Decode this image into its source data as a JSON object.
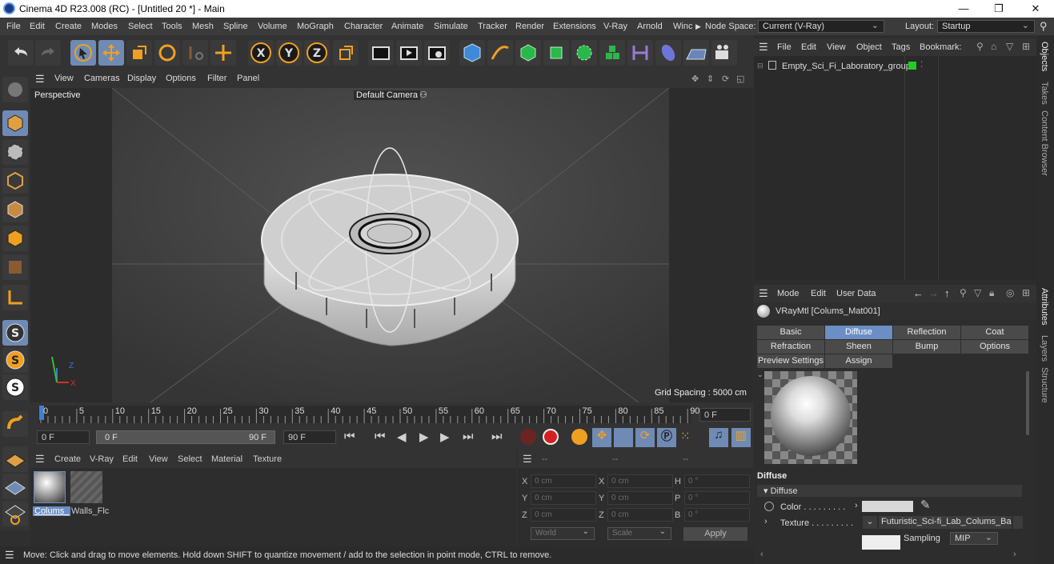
{
  "window": {
    "title": "Cinema 4D R23.008 (RC) - [Untitled 20 *] - Main"
  },
  "menu": {
    "items": [
      "File",
      "Edit",
      "Create",
      "Modes",
      "Select",
      "Tools",
      "Mesh",
      "Spline",
      "Volume",
      "MoGraph",
      "Character",
      "Animate",
      "Simulate",
      "Tracker",
      "Render",
      "Extensions",
      "V-Ray",
      "Arnold",
      "Winc"
    ],
    "node_space_label": "Node Space:",
    "node_space_value": "Current (V-Ray)",
    "layout_label": "Layout:",
    "layout_value": "Startup"
  },
  "viewport": {
    "menu": [
      "View",
      "Cameras",
      "Display",
      "Options",
      "Filter",
      "Panel"
    ],
    "name": "Perspective",
    "camera": "Default Camera",
    "grid_spacing": "Grid Spacing : 5000 cm",
    "axis_z": "Z",
    "axis_x": "X"
  },
  "timeline": {
    "ticks": [
      "0",
      "5",
      "10",
      "15",
      "20",
      "25",
      "30",
      "35",
      "40",
      "45",
      "50",
      "55",
      "60",
      "65",
      "70",
      "75",
      "80",
      "85",
      "90"
    ],
    "current_frame": "0 F",
    "start": "0 F",
    "range_start": "0 F",
    "range_end": "90 F",
    "end": "90 F"
  },
  "material_manager": {
    "menu": [
      "Create",
      "V-Ray",
      "Edit",
      "View",
      "Select",
      "Material",
      "Texture"
    ],
    "materials": [
      "Colums_",
      "Walls_Flc"
    ]
  },
  "coordinates": {
    "headers": [
      "--",
      "--",
      "--"
    ],
    "rows": [
      {
        "a": "X",
        "av": "0 cm",
        "b": "X",
        "bv": "0 cm",
        "c": "H",
        "cv": "0 °"
      },
      {
        "a": "Y",
        "av": "0 cm",
        "b": "Y",
        "bv": "0 cm",
        "c": "P",
        "cv": "0 °"
      },
      {
        "a": "Z",
        "av": "0 cm",
        "b": "Z",
        "bv": "0 cm",
        "c": "B",
        "cv": "0 °"
      }
    ],
    "world": "World",
    "scale": "Scale",
    "apply": "Apply"
  },
  "object_manager": {
    "menu": [
      "File",
      "Edit",
      "View",
      "Object",
      "Tags",
      "Bookmark:"
    ],
    "object": "Empty_Sci_Fi_Laboratory_group"
  },
  "attributes": {
    "menu": [
      "Mode",
      "Edit",
      "User Data"
    ],
    "material": "VRayMtl [Colums_Mat001]",
    "tabs": [
      "Basic",
      "Diffuse",
      "Reflection",
      "Coat",
      "Refraction",
      "Sheen",
      "Bump",
      "Options",
      "Preview Settings",
      "Assign"
    ],
    "section": "Diffuse",
    "group": "▾ Diffuse",
    "color_label": "Color . . . . . . . . .",
    "texture_label": "Texture . . . . . . . . .",
    "texture_value": "Futuristic_Sci-fi_Lab_Colums_Base",
    "sampling_label": "Sampling",
    "sampling_value": "MIP"
  },
  "sidetabs": [
    "Objects",
    "Takes",
    "Content Browser",
    "Attributes",
    "Layers",
    "Structure"
  ],
  "status": "Move: Click and drag to move elements. Hold down SHIFT to quantize movement / add to the selection in point mode, CTRL to remove.",
  "colors": {
    "accent": "#6b8ec4",
    "object_tag": "#22cc22",
    "axis_x": "#d43030",
    "axis_y": "#30c030",
    "axis_z": "#3a78d8"
  }
}
